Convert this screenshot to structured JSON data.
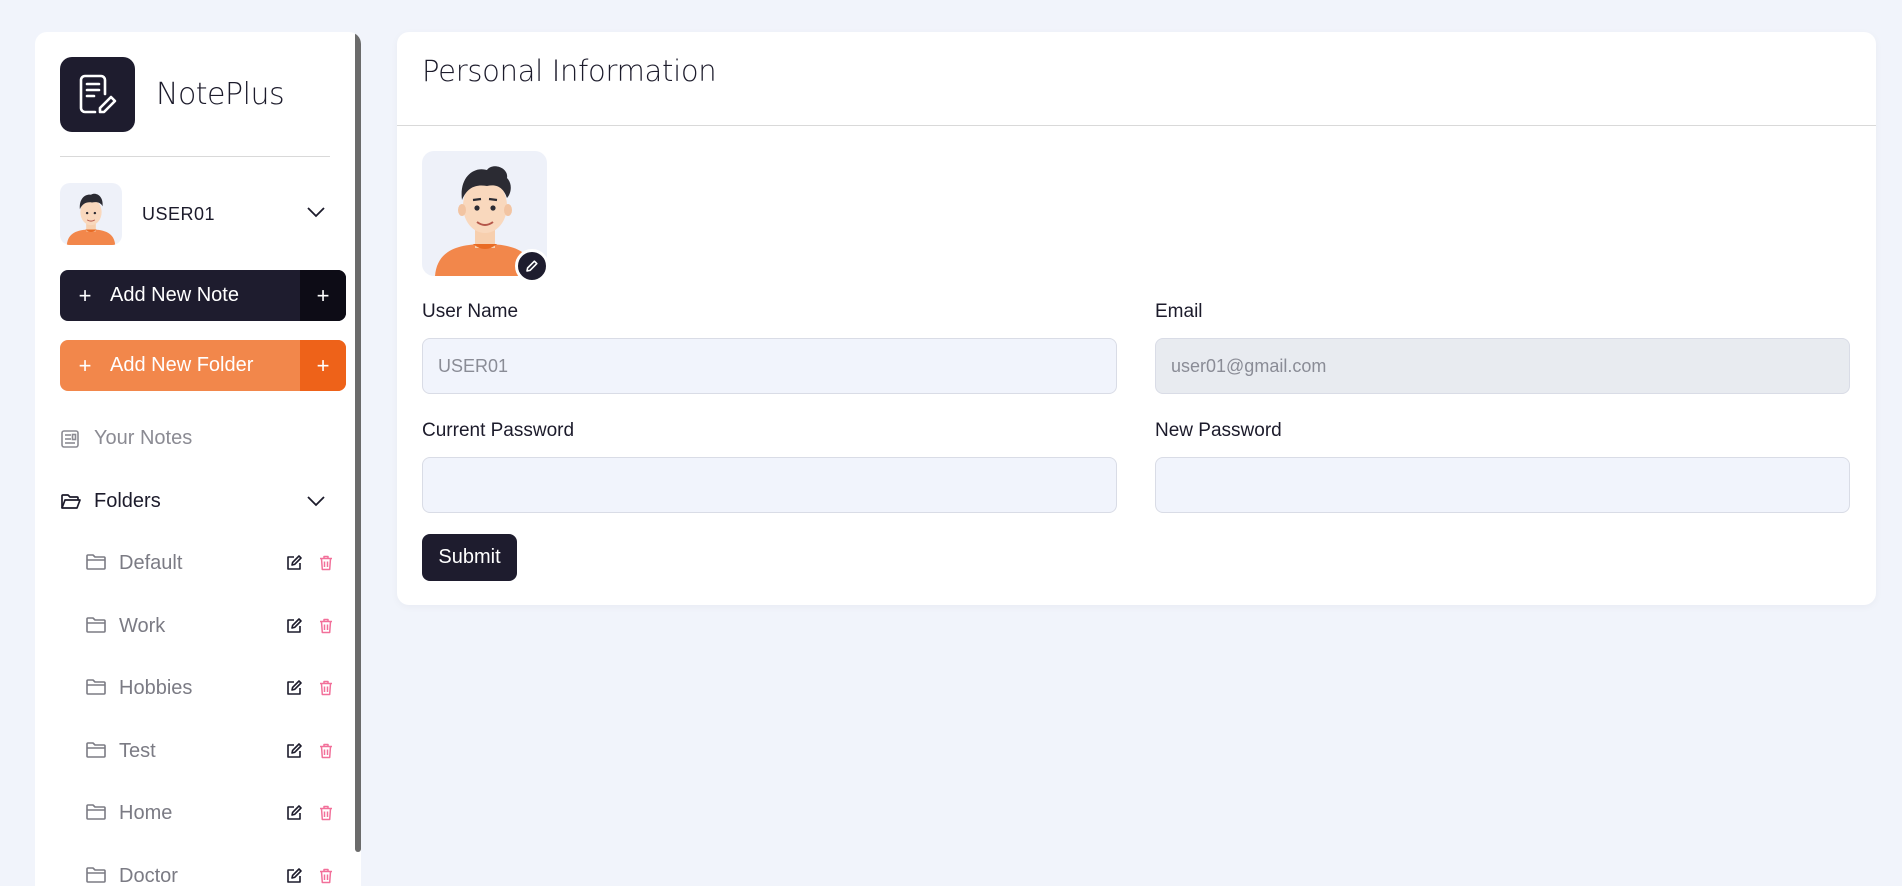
{
  "app": {
    "name": "NotePlus",
    "logo_icon": "note-edit-icon",
    "accent_dark": "#1e1c2e",
    "accent_orange": "#f2874b"
  },
  "user": {
    "name": "USER01",
    "avatar": "person-avatar"
  },
  "sidebar": {
    "add_note_label": "Add New Note",
    "add_folder_label": "Add New Folder",
    "plus_symbol": "+",
    "your_notes_label": "Your Notes",
    "folders_label": "Folders",
    "folders": [
      {
        "name": "Default"
      },
      {
        "name": "Work"
      },
      {
        "name": "Hobbies"
      },
      {
        "name": "Test"
      },
      {
        "name": "Home"
      },
      {
        "name": "Doctor"
      }
    ]
  },
  "profile": {
    "title": "Personal Information",
    "fields": {
      "username_label": "User Name",
      "username_value": "USER01",
      "email_label": "Email",
      "email_value": "user01@gmail.com",
      "current_password_label": "Current Password",
      "current_password_value": "",
      "new_password_label": "New Password",
      "new_password_value": ""
    },
    "submit_label": "Submit"
  }
}
